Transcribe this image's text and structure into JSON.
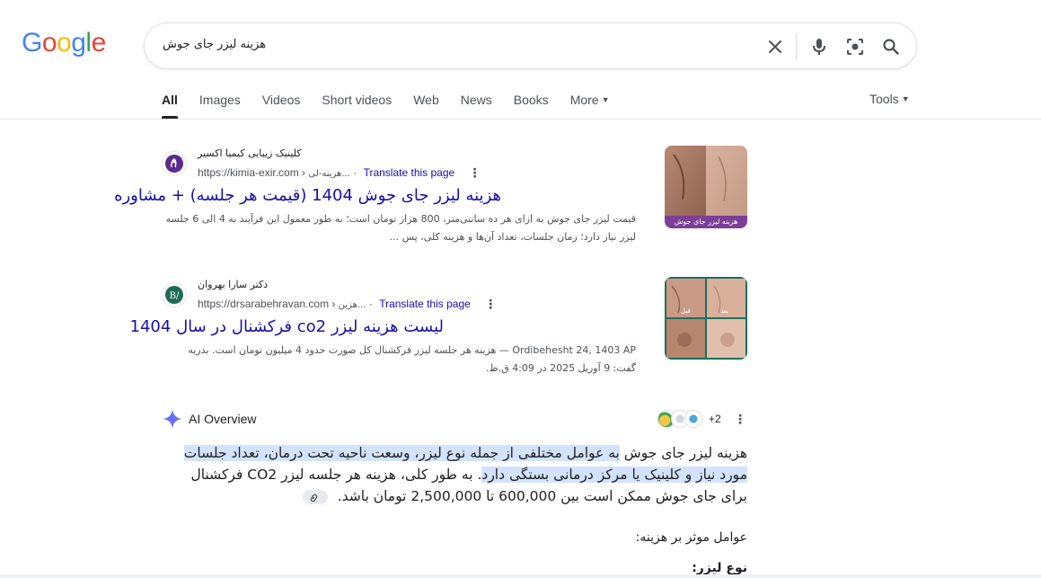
{
  "logo": {
    "letters": [
      "G",
      "o",
      "o",
      "g",
      "l",
      "e"
    ],
    "colors": [
      "#4285F4",
      "#EA4335",
      "#FBBC05",
      "#4285F4",
      "#34A853",
      "#EA4335"
    ]
  },
  "search": {
    "query": "هزینه لیزر جای جوش"
  },
  "tabs": [
    {
      "label": "All",
      "active": true
    },
    {
      "label": "Images"
    },
    {
      "label": "Videos"
    },
    {
      "label": "Short videos"
    },
    {
      "label": "Web"
    },
    {
      "label": "News"
    },
    {
      "label": "Books"
    },
    {
      "label": "More",
      "dropdown": true
    }
  ],
  "tools_label": "Tools",
  "results": [
    {
      "site_name": "کلینیک زیبایی کیمیا اکسیر",
      "url": "https://kimia-exir.com",
      "breadcrumb": "هزینه-لی...",
      "translate": "Translate this page",
      "title": "هزینه لیزر جای جوش 1404 (قیمت هر جلسه) + مشاوره",
      "snippet_lines": [
        "قیمت لیزر جای جوش به ازای هر ده سانتی‌متر، 800 هزار تومان است؛ به طور معمول این فرآیند به 4 الی 6 جلسه",
        "لیزر نیاز دارد؛ زمان جلسات، تعداد آن‌ها و هزینه کلی، پس ..."
      ],
      "thumb_caption": "هزینه لیزر جای جوش"
    },
    {
      "site_name": "دکتر سارا بهروان",
      "url": "https://drsarabehravan.com",
      "breadcrumb": "هزین...",
      "translate": "Translate this page",
      "title": "لیست هزینه لیزر co2 فرکشنال در سال 1404",
      "snippet_lines": [
        "Ordibehesht 24, 1403 AP — هزینه هر جلسه لیزر فرکشنال کل صورت حدود 4 میلیون تومان است. بدریه",
        "گفت: 9 آوریل 2025 در 4:09 ق.ظ."
      ],
      "thumb_labels": [
        "قبل",
        "بعد"
      ]
    }
  ],
  "ai_overview": {
    "title": "AI Overview",
    "sources_more": "+2",
    "paragraph_plain": "هزینه لیزر جای جوش ",
    "paragraph_highlight": "به عوامل مختلفی از جمله نوع لیزر، وسعت ناحیه تحت درمان، تعداد جلسات مورد نیاز و کلینیک یا مرکز درمانی بستگی دارد",
    "paragraph_rest": ". به طور کلی، هزینه هر جلسه لیزر CO2 فرکشنال برای جای جوش ممکن است بین 600,000 تا 2,500,000 تومان باشد.",
    "subheading": "عوامل موثر بر هزینه:",
    "sub_item": "نوع لیزر:"
  }
}
